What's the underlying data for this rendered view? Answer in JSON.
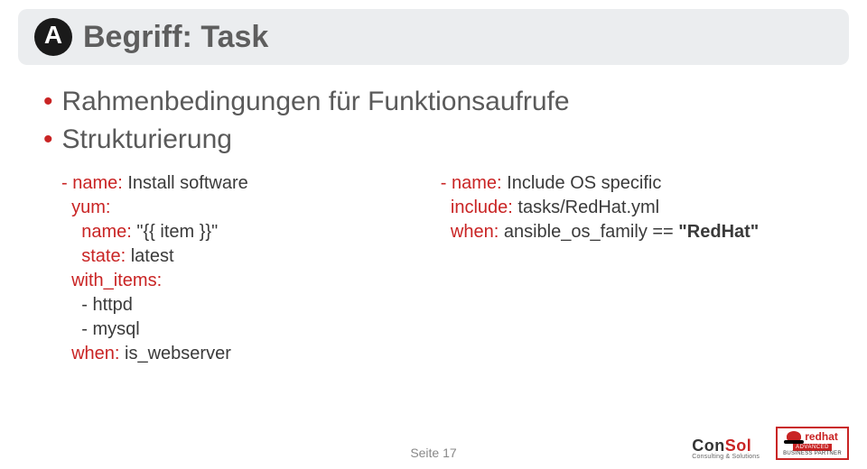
{
  "title": "Begriff: Task",
  "logo_letter": "A",
  "bullets": [
    "Rahmenbedingungen für Funktionsaufrufe",
    "Strukturierung"
  ],
  "code_left": {
    "l1a": "- name:",
    "l1b": " Install software",
    "l2": "  yum:",
    "l3a": "    name:",
    "l3b": " \"{{ item }}\"",
    "l4a": "    state:",
    "l4b": " latest",
    "l5": "  with_items:",
    "l6": "    - httpd",
    "l7": "    - mysql",
    "l8a": "  when:",
    "l8b": " is_webserver"
  },
  "code_right": {
    "l1a": "- name:",
    "l1b": " Include OS specific",
    "l2a": "  include:",
    "l2b": " tasks/RedHat.yml",
    "l3a": "  when:",
    "l3b": " ansible_os_family == ",
    "l3c": "\"RedHat\""
  },
  "footer": {
    "page": "Seite 17"
  },
  "brands": {
    "consol_con": "Con",
    "consol_sol": "Sol",
    "consol_sub": "Consulting & Solutions",
    "redhat": "redhat",
    "redhat_adv": "ADVANCED",
    "redhat_bp": "BUSINESS PARTNER"
  }
}
